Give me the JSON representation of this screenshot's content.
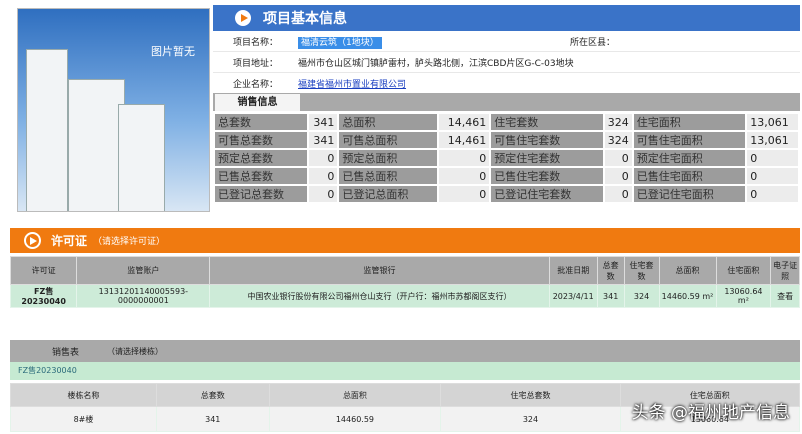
{
  "photo": {
    "placeholder": "图片暂无"
  },
  "project": {
    "title": "项目基本信息",
    "name_label": "项目名称：",
    "name_value": "福清云筑（1地块）",
    "district_label": "所在区县：",
    "district_value": "",
    "address_label": "项目地址：",
    "address_value": "福州市仓山区城门镇胪雷村，胪头路北侧，江滨CBD片区G-C-03地块",
    "company_label": "企业名称：",
    "company_value": "福建省福州市置业有限公司"
  },
  "sales_tab": "销售信息",
  "sales_grid": [
    [
      [
        "总套数",
        "341"
      ],
      [
        "总面积",
        "14,461"
      ],
      [
        "住宅套数",
        "324"
      ],
      [
        "住宅面积",
        "13,061"
      ]
    ],
    [
      [
        "可售总套数",
        "341"
      ],
      [
        "可售总面积",
        "14,461"
      ],
      [
        "可售住宅套数",
        "324"
      ],
      [
        "可售住宅面积",
        "13,061"
      ]
    ],
    [
      [
        "预定总套数",
        "0"
      ],
      [
        "预定总面积",
        "0"
      ],
      [
        "预定住宅套数",
        "0"
      ],
      [
        "预定住宅面积",
        "0"
      ]
    ],
    [
      [
        "已售总套数",
        "0"
      ],
      [
        "已售总面积",
        "0"
      ],
      [
        "已售住宅套数",
        "0"
      ],
      [
        "已售住宅面积",
        "0"
      ]
    ],
    [
      [
        "已登记总套数",
        "0"
      ],
      [
        "已登记总面积",
        "0"
      ],
      [
        "已登记住宅套数",
        "0"
      ],
      [
        "已登记住宅面积",
        "0"
      ]
    ]
  ],
  "permit": {
    "title": "许可证",
    "hint": "（请选择许可证）",
    "headers": [
      "许可证",
      "监管账户",
      "监管银行",
      "批准日期",
      "总套数",
      "住宅套数",
      "总面积",
      "住宅面积",
      "电子证照"
    ],
    "row": [
      "FZ售20230040",
      "13131201140005593-0000000001",
      "中国农业银行股份有限公司福州仓山支行（开户行：福州市苏都阁区支行）",
      "2023/4/11",
      "341",
      "324",
      "14460.59 m²",
      "13060.64 m²",
      "查看"
    ]
  },
  "sales_table": {
    "title": "销售表",
    "hint": "（请选择楼栋）",
    "permit_no": "FZ售20230040",
    "headers": [
      "楼栋名称",
      "总套数",
      "总面积",
      "住宅总套数",
      "住宅总面积"
    ],
    "row": [
      "8#楼",
      "341",
      "14460.59",
      "324",
      "13060.64"
    ]
  },
  "watermark": "头条 @福州地产信息"
}
